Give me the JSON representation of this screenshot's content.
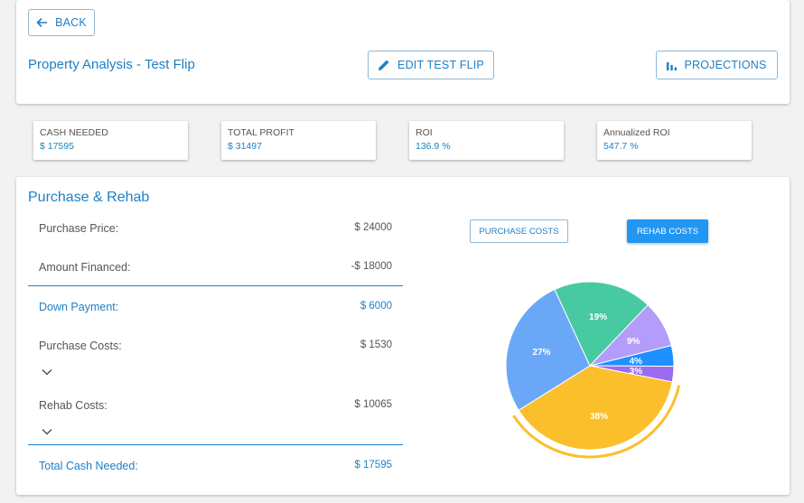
{
  "header": {
    "back_label": "BACK",
    "title": "Property Analysis - Test Flip",
    "edit_label": "EDIT TEST FLIP",
    "projections_label": "PROJECTIONS"
  },
  "stats": [
    {
      "label": "CASH NEEDED",
      "value": "$ 17595"
    },
    {
      "label": "TOTAL PROFIT",
      "value": "$ 31497"
    },
    {
      "label": "ROI",
      "value": "136.9 %"
    },
    {
      "label": "Annualized ROI",
      "value": "547.7 %"
    }
  ],
  "section": {
    "title": "Purchase & Rehab",
    "rows": {
      "purchase_price": {
        "label": "Purchase Price:",
        "value": "$ 24000"
      },
      "amount_financed": {
        "label": "Amount Financed:",
        "value": "-$ 18000"
      },
      "down_payment": {
        "label": "Down Payment:",
        "value": "$ 6000"
      },
      "purchase_costs": {
        "label": "Purchase Costs:",
        "value": "$ 1530"
      },
      "rehab_costs": {
        "label": "Rehab Costs:",
        "value": "$ 10065"
      },
      "total_cash": {
        "label": "Total Cash Needed:",
        "value": "$ 17595"
      }
    }
  },
  "chart_toggle": {
    "purchase_costs_label": "PURCHASE COSTS",
    "rehab_costs_label": "REHAB COSTS",
    "active": "rehab_costs"
  },
  "chart_data": {
    "type": "pie",
    "slices": [
      {
        "label": "4%",
        "value": 4,
        "color": "#1e90ff"
      },
      {
        "label": "3%",
        "value": 3,
        "color": "#9b6cf0"
      },
      {
        "label": "38%",
        "value": 38,
        "color": "#fbbf2c"
      },
      {
        "label": "27%",
        "value": 27,
        "color": "#6aa8f7"
      },
      {
        "label": "19%",
        "value": 19,
        "color": "#47c9a2"
      },
      {
        "label": "9%",
        "value": 9,
        "color": "#b49cfa"
      }
    ],
    "highlighted_slice": "38%"
  },
  "colors": {
    "accent": "#1e7fc6",
    "active_button": "#2196f3"
  }
}
